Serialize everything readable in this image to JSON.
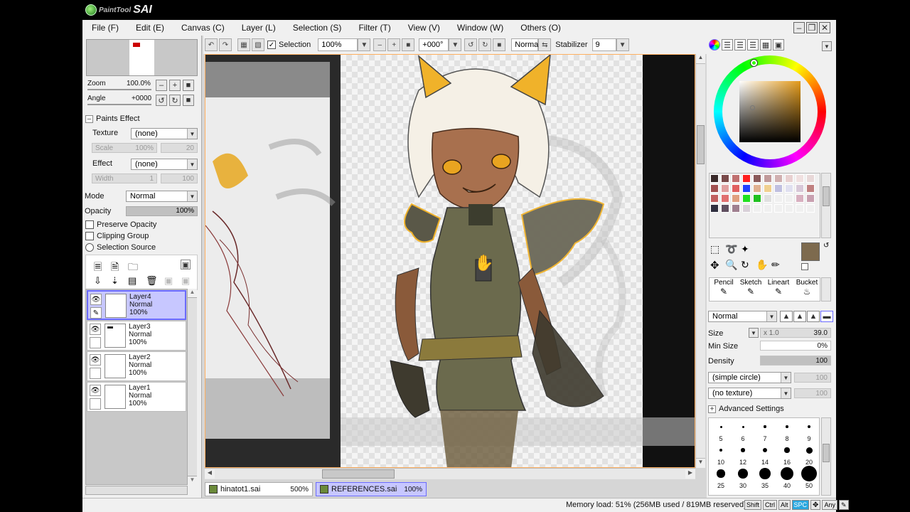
{
  "app": {
    "logo_small": "PaintTool",
    "logo_big": "SAI"
  },
  "menu": [
    {
      "label": "File (F)",
      "name": "menu-file"
    },
    {
      "label": "Edit (E)",
      "name": "menu-edit"
    },
    {
      "label": "Canvas (C)",
      "name": "menu-canvas"
    },
    {
      "label": "Layer (L)",
      "name": "menu-layer"
    },
    {
      "label": "Selection (S)",
      "name": "menu-selection"
    },
    {
      "label": "Filter (T)",
      "name": "menu-filter"
    },
    {
      "label": "View (V)",
      "name": "menu-view"
    },
    {
      "label": "Window (W)",
      "name": "menu-window"
    },
    {
      "label": "Others (O)",
      "name": "menu-others"
    }
  ],
  "navigator": {
    "zoom_label": "Zoom",
    "zoom_value": "100.0%",
    "angle_label": "Angle",
    "angle_value": "+0000"
  },
  "paints_effect": {
    "header": "Paints Effect",
    "texture_label": "Texture",
    "texture_value": "(none)",
    "scale_label": "Scale",
    "scale_value": "100%",
    "scale_num": "20",
    "effect_label": "Effect",
    "effect_value": "(none)",
    "width_label": "Width",
    "width_value": "1",
    "width_num": "100"
  },
  "layer_props": {
    "mode_label": "Mode",
    "mode_value": "Normal",
    "opacity_label": "Opacity",
    "opacity_value": "100%",
    "preserve_opacity": "Preserve Opacity",
    "clipping_group": "Clipping Group",
    "selection_source": "Selection Source"
  },
  "layers": [
    {
      "name": "Layer4",
      "mode": "Normal",
      "opacity": "100%",
      "selected": true
    },
    {
      "name": "Layer3",
      "mode": "Normal",
      "opacity": "100%",
      "selected": false
    },
    {
      "name": "Layer2",
      "mode": "Normal",
      "opacity": "100%",
      "selected": false
    },
    {
      "name": "Layer1",
      "mode": "Normal",
      "opacity": "100%",
      "selected": false
    }
  ],
  "toolbar": {
    "selection_label": "Selection",
    "zoom": "100%",
    "angle": "+000°",
    "blend": "Normal",
    "stabilizer_label": "Stabilizer",
    "stabilizer_value": "9"
  },
  "tabs": [
    {
      "name": "hinatot1.sai",
      "zoom": "500%",
      "active": false
    },
    {
      "name": "REFERENCES.sai",
      "zoom": "100%",
      "active": true
    }
  ],
  "tools": [
    {
      "label": "Pencil"
    },
    {
      "label": "Sketch"
    },
    {
      "label": "Lineart"
    },
    {
      "label": "Bucket"
    }
  ],
  "brush": {
    "blend_mode": "Normal",
    "size_label": "Size",
    "size_mult": "x 1.0",
    "size_value": "39.0",
    "min_size_label": "Min Size",
    "min_size_value": "0%",
    "density_label": "Density",
    "density_value": "100",
    "shape": "(simple circle)",
    "shape_num": "100",
    "texture": "(no texture)",
    "texture_num": "100",
    "advanced_label": "Advanced Settings",
    "size_presets": [
      "5",
      "6",
      "7",
      "8",
      "9",
      "10",
      "12",
      "14",
      "16",
      "20",
      "25",
      "30",
      "35",
      "40",
      "50"
    ]
  },
  "status": {
    "memory": "Memory load: 51% (256MB used / 819MB reserved)",
    "keys": [
      "Shift",
      "Ctrl",
      "Alt",
      "SPC",
      "Any"
    ]
  },
  "colors": {
    "accent": "#6a6aff",
    "primary_color": "#7d6a4e",
    "swatches": [
      "#3a2a2a",
      "#7a4a4a",
      "#c07070",
      "#ff2020",
      "#8a5a5a",
      "#c09a9a",
      "#d0b0b0",
      "#e8d0d0",
      "#f0e0e0",
      "#e8d8d8",
      "#a05050",
      "#e0a0a0",
      "#e06060",
      "#2040ff",
      "#e0b090",
      "#f0d090",
      "#c0c0e0",
      "#e0e0f0",
      "#d8c8d8",
      "#c08080",
      "#c06060",
      "#e07070",
      "#e0a080",
      "#20e020",
      "#20c020",
      "#e0e0e0",
      "#f0f0f0",
      "#f0f0f0",
      "#d8b0c0",
      "#c8a0b0",
      "#303040",
      "#605060",
      "#a08090",
      "#d8d0d8",
      "#f0f0f0",
      "#f0f0f0",
      "#f0f0f0",
      "#f0f0f0",
      "#f0f0f0",
      "#f0f0f0"
    ]
  }
}
